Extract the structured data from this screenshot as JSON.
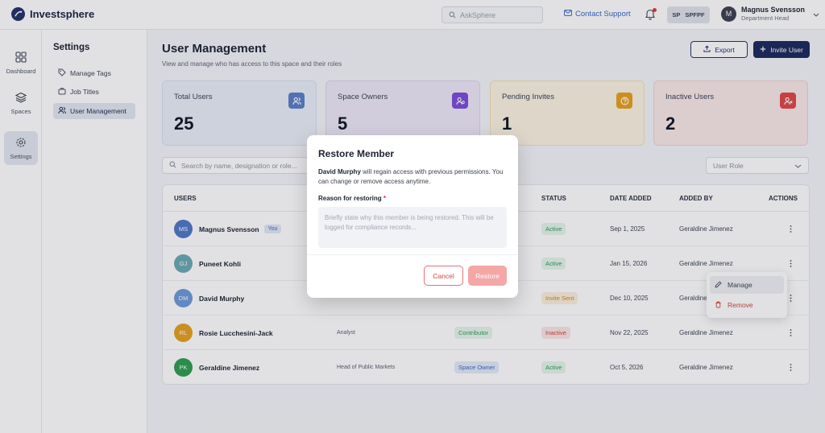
{
  "app": {
    "name": "Investsphere"
  },
  "header": {
    "search_placeholder": "AskSphere",
    "contact_label": "Contact Support",
    "space_chip": {
      "initials": "SP",
      "code": "SPFPF"
    },
    "user": {
      "initial": "M",
      "name": "Magnus Svensson",
      "role": "Department Head"
    }
  },
  "rail": {
    "items": [
      {
        "label": "Dashboard",
        "icon": "dashboard-icon"
      },
      {
        "label": "Spaces",
        "icon": "layers-icon"
      },
      {
        "label": "Settings",
        "icon": "gear-icon",
        "active": true
      }
    ]
  },
  "sidebar": {
    "title": "Settings",
    "items": [
      {
        "label": "Manage Tags",
        "icon": "tag-icon"
      },
      {
        "label": "Job Titles",
        "icon": "briefcase-icon"
      },
      {
        "label": "User Management",
        "icon": "users-icon",
        "active": true
      }
    ]
  },
  "main": {
    "title": "User Management",
    "subtitle": "View and manage  who has access to this space and their roles",
    "export_label": "Export",
    "invite_label": "Invite User"
  },
  "stats": [
    {
      "label": "Total Users",
      "value": "25",
      "color": "#5b7fc7",
      "bg": "#e9eef8",
      "border": "#d5def0"
    },
    {
      "label": "Space Owners",
      "value": "5",
      "color": "#7c4ed8",
      "bg": "#eee9f8",
      "border": "#ddd3f1"
    },
    {
      "label": "Pending Invites",
      "value": "1",
      "color": "#e6a11f",
      "bg": "#fbf3e2",
      "border": "#f0dfb7"
    },
    {
      "label": "Inactive Users",
      "value": "2",
      "color": "#e04848",
      "bg": "#fae8e8",
      "border": "#f0cfcf"
    }
  ],
  "filters": {
    "search_placeholder": "Search by name, designation or role...",
    "role_placeholder": "User Role"
  },
  "table": {
    "headers": {
      "users": "USERS",
      "status": "STATUS",
      "date_added": "DATE ADDED",
      "added_by": "ADDED BY",
      "actions": "ACTIONS"
    },
    "rows": [
      {
        "initials": "MS",
        "avatar_color": "#4d79c9",
        "name": "Magnus Svensson",
        "you": "You",
        "designation": "",
        "role": "",
        "status": "Active",
        "status_color": "#2f9e5a",
        "status_bg": "#e4f5ea",
        "date": "Sep 1, 2025",
        "added_by": "Geraldine Jimenez"
      },
      {
        "initials": "GJ",
        "avatar_color": "#6aa9b4",
        "name": "Puneet Kohli",
        "you": "",
        "designation": "",
        "role": "",
        "status": "Active",
        "status_color": "#2f9e5a",
        "status_bg": "#e4f5ea",
        "date": "Jan 15, 2026",
        "added_by": "Geraldine Jimenez"
      },
      {
        "initials": "DM",
        "avatar_color": "#6b9bd8",
        "name": "David Murphy",
        "you": "",
        "designation": "",
        "role": "",
        "status": "Invite Sent",
        "status_color": "#d58a1a",
        "status_bg": "#fcefdc",
        "date": "Dec 10, 2025",
        "added_by": "Geraldine Jimenez"
      },
      {
        "initials": "RL",
        "avatar_color": "#e6a11f",
        "name": "Rosie Lucchesini-Jack",
        "you": "",
        "designation": "Analyst",
        "role": "Contributor",
        "role_color": "#2f9e5a",
        "role_bg": "#e4f5ea",
        "status": "Inactive",
        "status_color": "#d6453b",
        "status_bg": "#fbe5e4",
        "date": "Nov 22, 2025",
        "added_by": "Geraldine Jimenez"
      },
      {
        "initials": "PK",
        "avatar_color": "#2e9e52",
        "name": "Geraldine Jimenez",
        "you": "",
        "designation": "Head of Public Markets",
        "role": "Space Owner",
        "role_color": "#3d68c2",
        "role_bg": "#e2eaf8",
        "status": "Active",
        "status_color": "#2f9e5a",
        "status_bg": "#e4f5ea",
        "date": "Oct 5, 2026",
        "added_by": "Geraldine Jimenez"
      }
    ]
  },
  "dropdown": {
    "items": [
      {
        "label": "Manage",
        "icon": "pencil-icon",
        "color": "#3e4555"
      },
      {
        "label": "Remove",
        "icon": "trash-icon",
        "color": "#d6453b"
      }
    ]
  },
  "modal": {
    "title": "Restore Member",
    "member_name": "David Murphy",
    "description": " will regain access with previous permissions. You can change or remove access anytime.",
    "reason_label": "Reason for restoring",
    "required_mark": "*",
    "reason_placeholder": "Briefly state why this member is being restored. This will be logged for compliance records...",
    "cancel_label": "Cancel",
    "restore_label": "Restore"
  }
}
